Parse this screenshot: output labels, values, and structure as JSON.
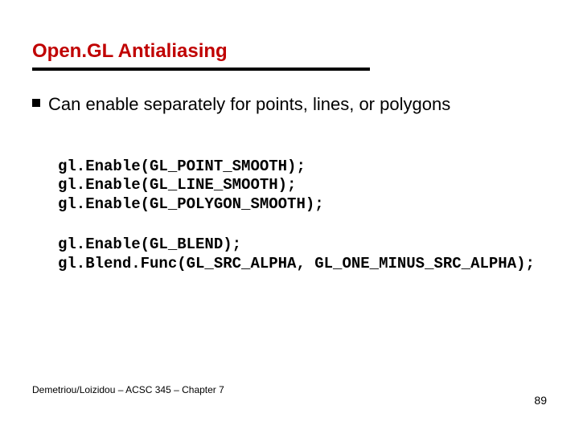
{
  "title": "Open.GL Antialiasing",
  "bullet": "Can enable separately for points, lines, or polygons",
  "code1": "gl.Enable(GL_POINT_SMOOTH);\ngl.Enable(GL_LINE_SMOOTH);\ngl.Enable(GL_POLYGON_SMOOTH);",
  "code2": "gl.Enable(GL_BLEND);\ngl.Blend.Func(GL_SRC_ALPHA, GL_ONE_MINUS_SRC_ALPHA);",
  "footer_left": "Demetriou/Loizidou – ACSC 345 – Chapter 7",
  "footer_right": "89"
}
